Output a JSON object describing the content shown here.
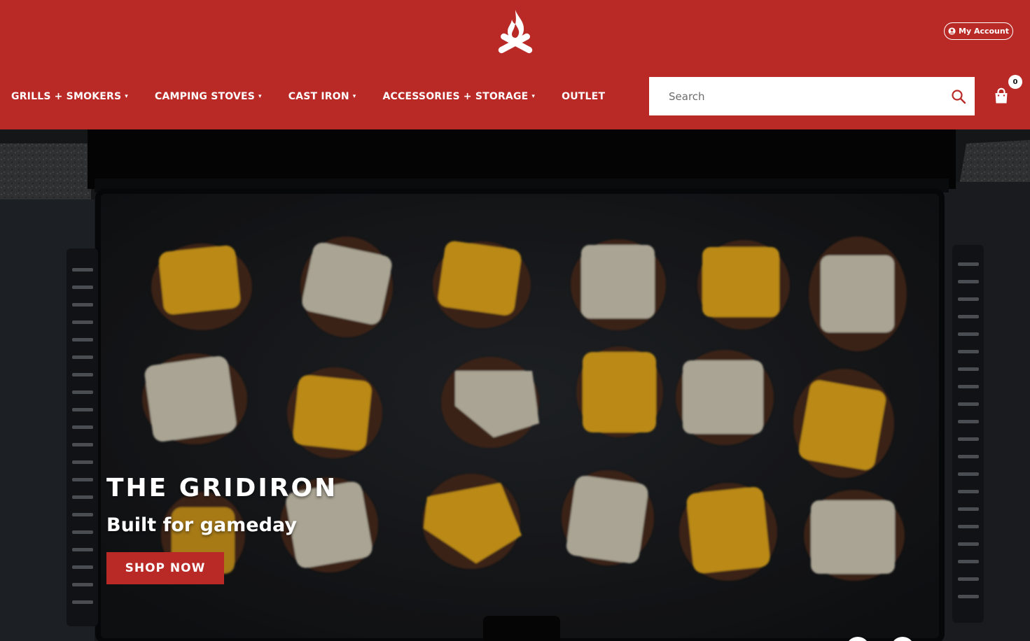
{
  "header": {
    "background": "#b92a27",
    "logo_icon": "campfire-icon",
    "account_label": "My Account",
    "account_icon": "user-circle-icon"
  },
  "nav": {
    "items": [
      {
        "label": "GRILLS + SMOKERS",
        "has_dropdown": true
      },
      {
        "label": "CAMPING STOVES",
        "has_dropdown": true
      },
      {
        "label": "CAST IRON",
        "has_dropdown": true
      },
      {
        "label": "ACCESSORIES + STORAGE",
        "has_dropdown": true
      },
      {
        "label": "OUTLET",
        "has_dropdown": false
      }
    ],
    "caret": "▾"
  },
  "search": {
    "placeholder": "Search",
    "value": "",
    "icon": "search-icon"
  },
  "cart": {
    "icon": "shopping-bag-icon",
    "count": "0"
  },
  "hero": {
    "title": "THE GRIDIRON",
    "subtitle": "Built for gameday",
    "cta_label": "SHOP NOW",
    "cta_color": "#b92a27",
    "image": "griddle-with-cheese-smash-burgers"
  }
}
